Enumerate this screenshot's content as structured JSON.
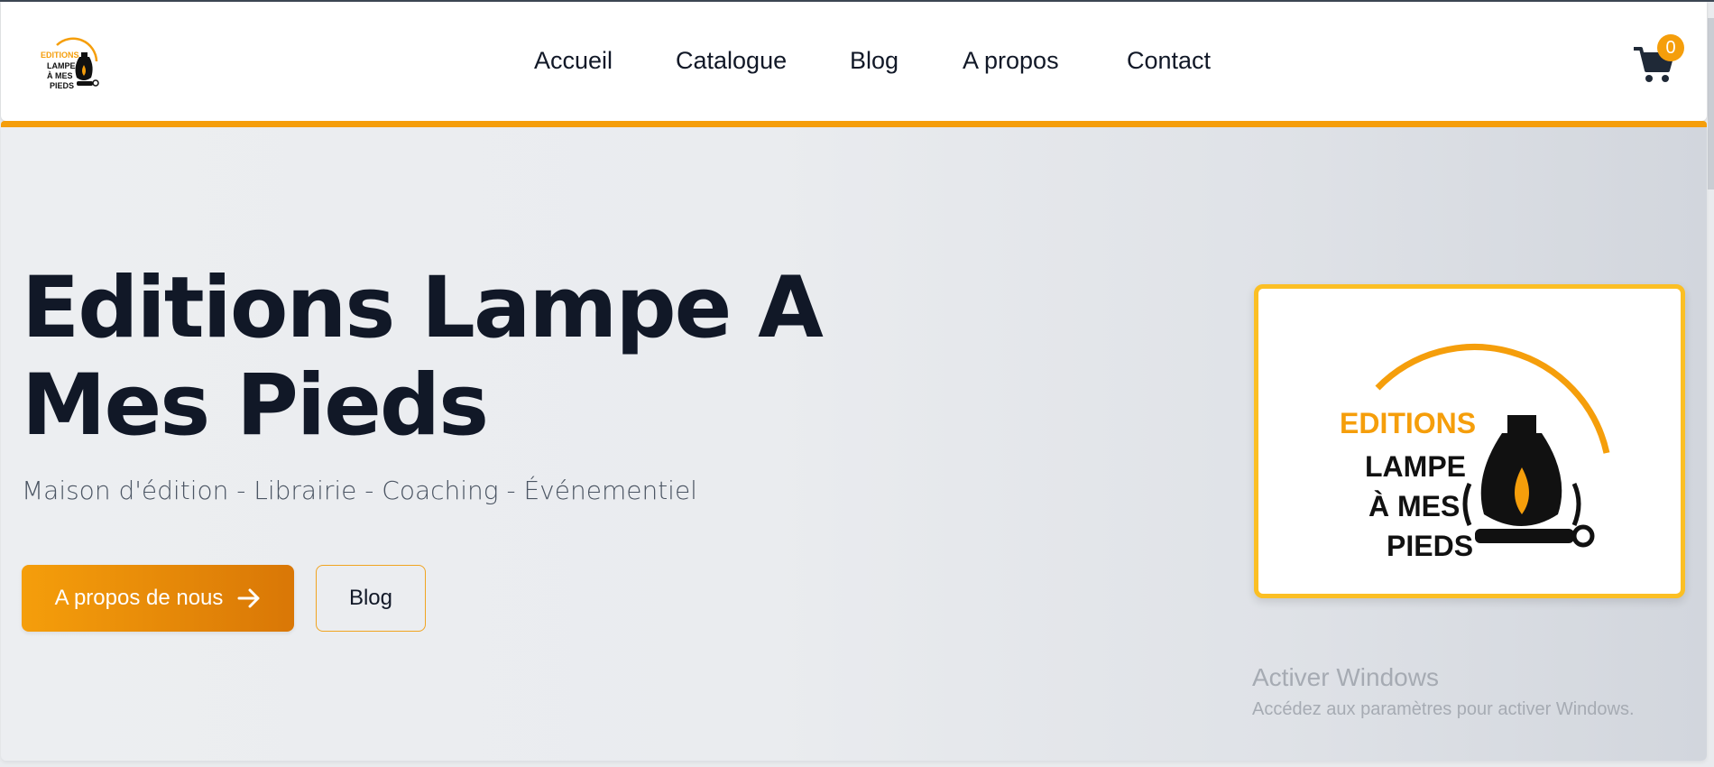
{
  "colors": {
    "accent": "#f59e0b",
    "accent_dark": "#d97706",
    "heading": "#111827",
    "subtitle": "#4b5563",
    "card_border": "#fbbf24"
  },
  "nav": {
    "logo": {
      "icon": "editions-lampe-logo",
      "text_editions": "EDITIONS",
      "text_line1": "LAMPE",
      "text_line2": "À MES",
      "text_line3": "PIEDS"
    },
    "links": [
      {
        "label": "Accueil"
      },
      {
        "label": "Catalogue"
      },
      {
        "label": "Blog"
      },
      {
        "label": "A propos"
      },
      {
        "label": "Contact"
      }
    ],
    "cart": {
      "icon": "shopping-cart-icon",
      "count": "0"
    }
  },
  "hero": {
    "title_line1": "Editions Lampe A",
    "title_line2": "Mes Pieds",
    "subtitle": "Maison d'édition - Librairie - Coaching - Événementiel",
    "primary_button": {
      "label": "A propos de nous",
      "icon": "arrow-right-icon"
    },
    "secondary_button": {
      "label": "Blog"
    }
  },
  "logo_card": {
    "icon": "editions-lampe-logo",
    "text_editions": "EDITIONS",
    "text_line1": "LAMPE",
    "text_line2": "À MES",
    "text_line3": "PIEDS"
  },
  "watermark": {
    "title": "Activer Windows",
    "subtitle": "Accédez aux paramètres pour activer Windows."
  }
}
